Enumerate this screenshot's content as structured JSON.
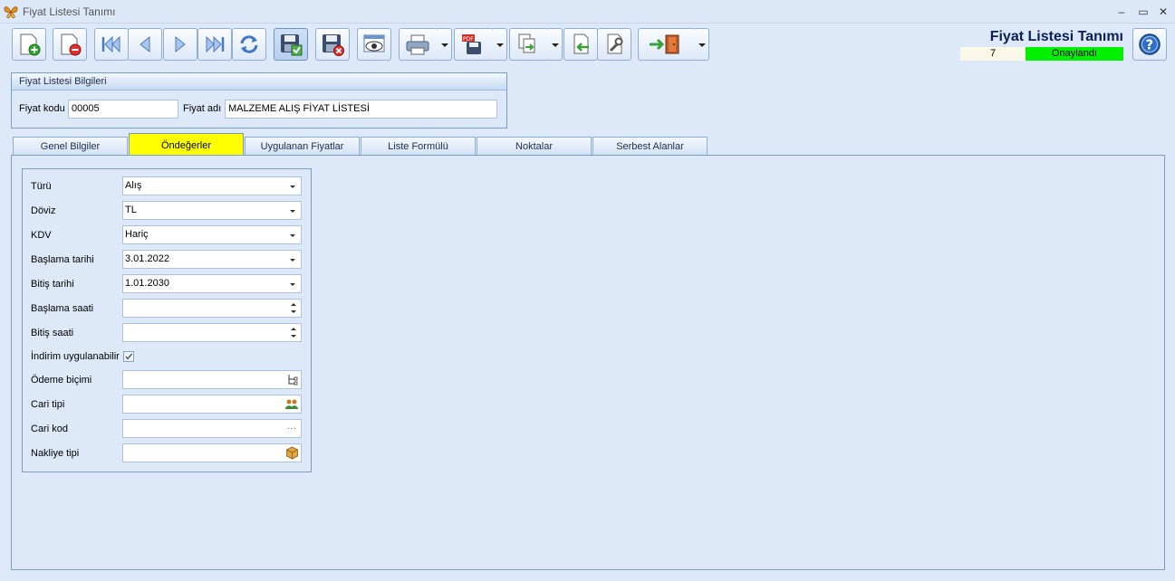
{
  "window": {
    "title": "Fiyat Listesi Tanımı",
    "controls": {
      "minimize": "‒",
      "maximize": "▭",
      "close": "✕"
    }
  },
  "toolbar": {
    "buttons": [
      {
        "icon": "new-document-icon"
      },
      {
        "icon": "delete-document-icon"
      },
      {
        "icon": "first-record-icon"
      },
      {
        "icon": "previous-record-icon"
      },
      {
        "icon": "next-record-icon"
      },
      {
        "icon": "last-record-icon"
      },
      {
        "icon": "refresh-icon"
      },
      {
        "icon": "save-approve-icon"
      },
      {
        "icon": "save-cancel-icon"
      },
      {
        "icon": "preview-icon"
      },
      {
        "icon": "print-icon"
      },
      {
        "icon": "pdf-export-icon"
      },
      {
        "icon": "copy-document-icon"
      },
      {
        "icon": "import-document-icon"
      },
      {
        "icon": "settings-wrench-icon"
      },
      {
        "icon": "exit-door-icon"
      }
    ]
  },
  "header": {
    "form_title": "Fiyat Listesi Tanımı",
    "record_number": "7",
    "status": "Onaylandı",
    "status_color": "#00f000"
  },
  "info_group": {
    "title": "Fiyat Listesi Bilgileri",
    "code_label": "Fiyat kodu",
    "code_value": "00005",
    "name_label": "Fiyat adı",
    "name_value": "MALZEME ALIŞ FİYAT LİSTESİ"
  },
  "tabs": [
    {
      "label": "Genel Bilgiler"
    },
    {
      "label": "Öndeğerler",
      "active": true
    },
    {
      "label": "Uygulanan Fiyatlar"
    },
    {
      "label": "Liste Formülü"
    },
    {
      "label": "Noktalar"
    },
    {
      "label": "Serbest Alanlar"
    }
  ],
  "defaults": {
    "type_label": "Türü",
    "type_value": "Alış",
    "currency_label": "Döviz",
    "currency_value": "TL",
    "vat_label": "KDV",
    "vat_value": "Hariç",
    "start_date_label": "Başlama tarihi",
    "start_date_value": "3.01.2022",
    "end_date_label": "Bitiş tarihi",
    "end_date_value": "1.01.2030",
    "start_time_label": "Başlama saati",
    "start_time_value": "",
    "end_time_label": "Bitiş saati",
    "end_time_value": "",
    "discount_label": "İndirim uygulanabilir",
    "discount_checked": true,
    "payment_label": "Ödeme biçimi",
    "payment_value": "",
    "account_type_label": "Cari tipi",
    "account_type_value": "",
    "account_code_label": "Cari kod",
    "account_code_value": "",
    "shipping_label": "Nakliye tipi",
    "shipping_value": "",
    "ellipsis": "···"
  }
}
